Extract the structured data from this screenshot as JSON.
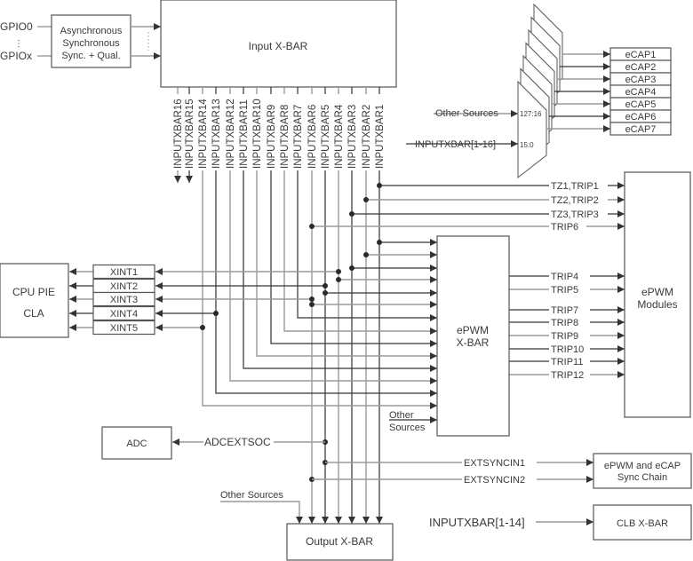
{
  "diagram": {
    "gpio": {
      "first": "GPIO0",
      "last": "GPIOx",
      "ellipsis": "⋮"
    },
    "sync_block": {
      "lines": [
        "Asynchronous",
        "Synchronous",
        "Sync. + Qual."
      ]
    },
    "input_xbar": {
      "label": "Input X-BAR"
    },
    "input_xbar_outputs": [
      "INPUTXBAR16",
      "INPUTXBAR15",
      "INPUTXBAR14",
      "INPUTXBAR13",
      "INPUTXBAR12",
      "INPUTXBAR11",
      "INPUTXBAR10",
      "INPUTXBAR9",
      "INPUTXBAR8",
      "INPUTXBAR7",
      "INPUTXBAR6",
      "INPUTXBAR5",
      "INPUTXBAR4",
      "INPUTXBAR3",
      "INPUTXBAR2",
      "INPUTXBAR1"
    ],
    "ecap_mux": {
      "other_sources": "Other Sources",
      "other_sources_range": "127:16",
      "inputxbar": "INPUTXBAR[1-16]",
      "inputxbar_range": "15:0",
      "outputs": [
        "eCAP1",
        "eCAP2",
        "eCAP3",
        "eCAP4",
        "eCAP5",
        "eCAP6",
        "eCAP7"
      ]
    },
    "epwm_direct": [
      "TZ1,TRIP1",
      "TZ2,TRIP2",
      "TZ3,TRIP3",
      "TRIP6"
    ],
    "epwm_xbar": {
      "lines": [
        "ePWM",
        "X-BAR"
      ],
      "other_sources": [
        "Other",
        "Sources"
      ]
    },
    "epwm_xbar_outputs": [
      "TRIP4",
      "TRIP5",
      "TRIP7",
      "TRIP8",
      "TRIP9",
      "TRIP10",
      "TRIP11",
      "TRIP12"
    ],
    "epwm_modules": {
      "lines": [
        "ePWM",
        "Modules"
      ]
    },
    "cpu_pie": {
      "lines": [
        "CPU PIE",
        "CLA"
      ]
    },
    "xints": [
      "XINT1",
      "XINT2",
      "XINT3",
      "XINT4",
      "XINT5"
    ],
    "adc": {
      "label": "ADC",
      "signal": "ADCEXTSOC"
    },
    "sync": {
      "signals": [
        "EXTSYNCIN1",
        "EXTSYNCIN2"
      ],
      "target_lines": [
        "ePWM and eCAP",
        "Sync Chain"
      ]
    },
    "output_xbar": {
      "label": "Output X-BAR",
      "other_sources": "Other Sources"
    },
    "clb": {
      "signal": "INPUTXBAR[1-14]",
      "label": "CLB X-BAR"
    }
  }
}
